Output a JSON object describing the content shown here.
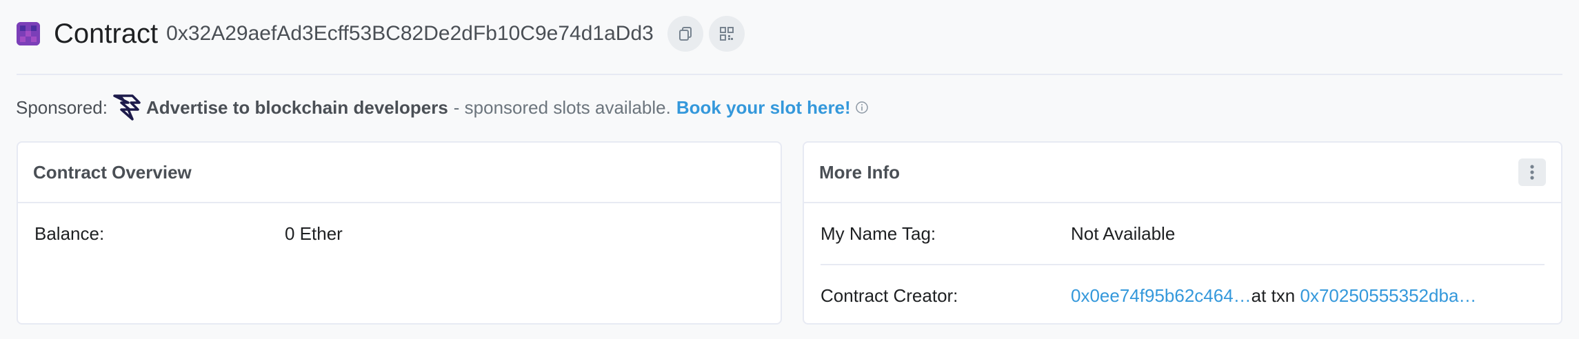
{
  "header": {
    "title": "Contract",
    "address": "0x32A29aefAd3Ecff53BC82De2dFb10C9e74d1aDd3"
  },
  "sponsored": {
    "label": "Sponsored:",
    "headline": "Advertise to blockchain developers",
    "tail": "- sponsored slots available.",
    "cta": "Book your slot here!"
  },
  "overview": {
    "title": "Contract Overview",
    "balance_label": "Balance:",
    "balance_value": "0 Ether"
  },
  "more_info": {
    "title": "More Info",
    "name_tag_label": "My Name Tag:",
    "name_tag_value": "Not Available",
    "creator_label": "Contract Creator:",
    "creator_address": "0x0ee74f95b62c464…",
    "at_txn": "at txn",
    "creator_txn": "0x70250555352dba…"
  },
  "colors": {
    "accent": "#3498db",
    "text": "#1e2022",
    "muted": "#6c757d",
    "border": "#e7eaf3",
    "background": "#f8f9fa"
  },
  "icons": {
    "avatar": "contract-identicon",
    "copy": "copy-icon",
    "qr": "qr-code-icon",
    "sponsor_logo": "sponsor-logo-icon",
    "info": "info-icon",
    "menu": "kebab-menu-icon"
  }
}
